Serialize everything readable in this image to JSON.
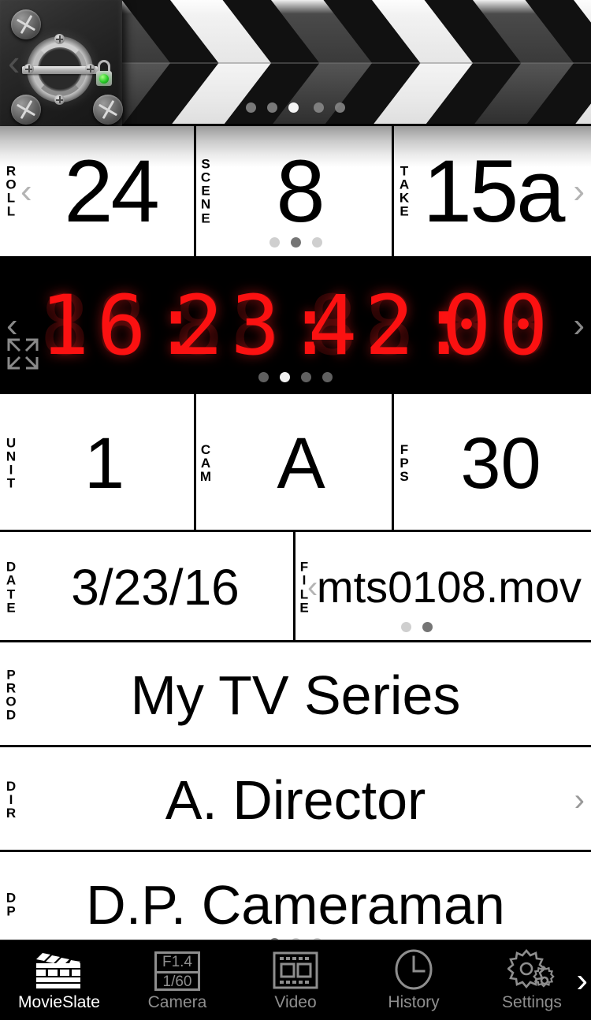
{
  "app": {
    "name": "MovieSlate"
  },
  "clapper": {
    "lock_state": "unlocked",
    "led_color": "#2ecc2e",
    "dots": {
      "count": 5,
      "active_index": 2
    }
  },
  "slate": {
    "rows": [
      {
        "id": "roll-scene-take",
        "fields": [
          {
            "label": "ROLL",
            "label_chars": [
              "R",
              "O",
              "L",
              "L"
            ],
            "value": "24"
          },
          {
            "label": "SCENE",
            "label_chars": [
              "S",
              "C",
              "E",
              "N",
              "E"
            ],
            "value": "8"
          },
          {
            "label": "TAKE",
            "label_chars": [
              "T",
              "A",
              "K",
              "E"
            ],
            "value": "15a"
          }
        ],
        "dots": {
          "count": 3,
          "active_index": 1
        }
      },
      {
        "id": "timecode",
        "value": "16:23:42:00",
        "digits": [
          "1",
          "6",
          "2",
          "3",
          "4",
          "2",
          "0",
          "0"
        ],
        "display_type": "7-segment-led",
        "color": "#fb1111",
        "dots": {
          "count": 4,
          "active_index": 1
        }
      },
      {
        "id": "unit-cam-fps",
        "fields": [
          {
            "label": "UNIT",
            "label_chars": [
              "U",
              "N",
              "I",
              "T"
            ],
            "value": "1"
          },
          {
            "label": "CAM",
            "label_chars": [
              "C",
              "A",
              "M"
            ],
            "value": "A"
          },
          {
            "label": "FPS",
            "label_chars": [
              "F",
              "P",
              "S"
            ],
            "value": "30"
          }
        ]
      },
      {
        "id": "date-file",
        "fields": [
          {
            "label": "DATE",
            "label_chars": [
              "D",
              "A",
              "T",
              "E"
            ],
            "value": "3/23/16"
          },
          {
            "label": "FILE",
            "label_chars": [
              "F",
              "I",
              "L",
              "E"
            ],
            "value": "mts0108.mov"
          }
        ],
        "dots": {
          "count": 2,
          "active_index": 1
        }
      },
      {
        "id": "prod",
        "fields": [
          {
            "label": "PROD",
            "label_chars": [
              "P",
              "R",
              "O",
              "D"
            ],
            "value": "My TV Series"
          }
        ]
      },
      {
        "id": "dir",
        "fields": [
          {
            "label": "DIR",
            "label_chars": [
              "D",
              "I",
              "R"
            ],
            "value": "A. Director"
          }
        ]
      },
      {
        "id": "dp",
        "fields": [
          {
            "label": "DP",
            "label_chars": [
              "D",
              "P"
            ],
            "value": "D.P. Cameraman"
          }
        ],
        "dots": {
          "count": 3,
          "active_index": 0
        }
      }
    ]
  },
  "tabbar": {
    "items": [
      {
        "label": "MovieSlate",
        "icon": "clapperboard-icon",
        "active": true
      },
      {
        "label": "Camera",
        "icon": "camera-exposure-icon",
        "active": false,
        "aperture": "F1.4",
        "shutter": "1/60"
      },
      {
        "label": "Video",
        "icon": "film-strip-icon",
        "active": false
      },
      {
        "label": "History",
        "icon": "clock-icon",
        "active": false
      },
      {
        "label": "Settings",
        "icon": "gears-icon",
        "active": false
      }
    ],
    "more_chevron": "›"
  },
  "glyphs": {
    "chev_left": "‹",
    "chev_right": "›"
  }
}
